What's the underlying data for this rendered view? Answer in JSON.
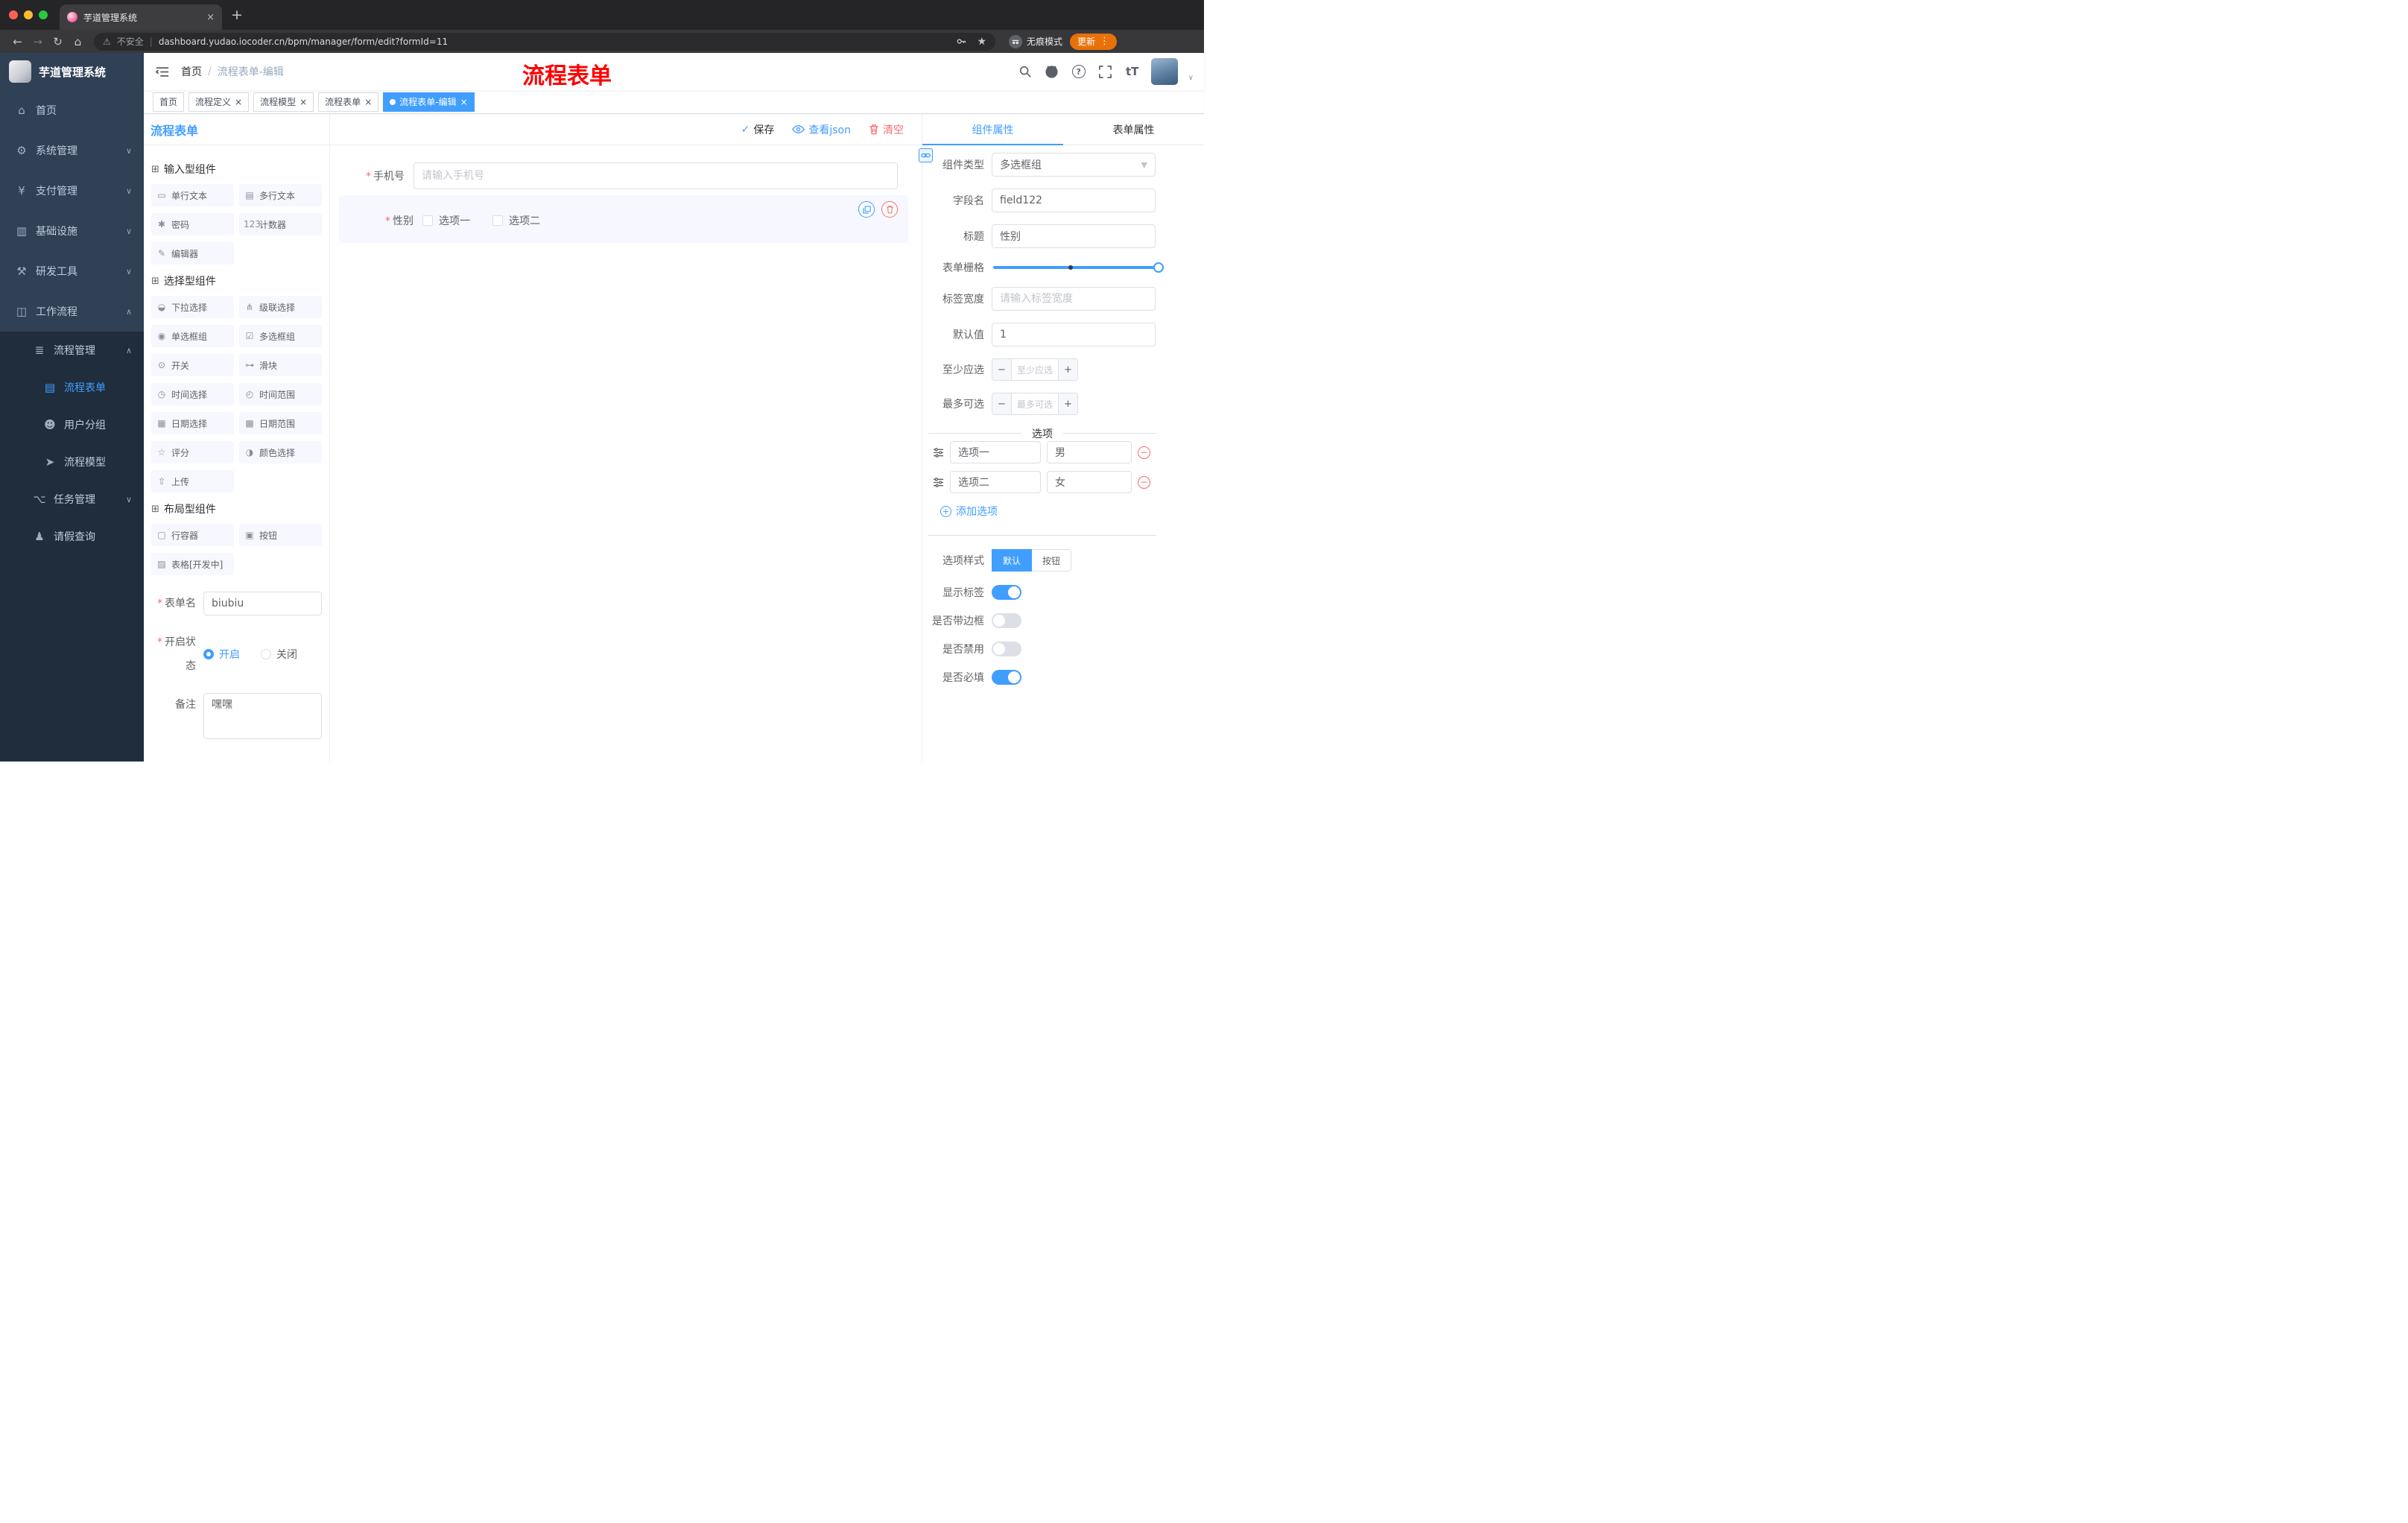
{
  "browser": {
    "tab_title": "芋道管理系统",
    "security_label": "不安全",
    "url": "dashboard.yudao.iocoder.cn/bpm/manager/form/edit?formId=11",
    "incognito_label": "无痕模式",
    "update_label": "更新"
  },
  "sidebar": {
    "logo_title": "芋道管理系统",
    "menu": [
      {
        "label": "首页",
        "icon": "⌂",
        "cls": "lvl0",
        "chev": ""
      },
      {
        "label": "系统管理",
        "icon": "⚙",
        "cls": "lvl0",
        "chev": "∨"
      },
      {
        "label": "支付管理",
        "icon": "¥",
        "cls": "lvl0",
        "chev": "∨"
      },
      {
        "label": "基础设施",
        "icon": "▥",
        "cls": "lvl0",
        "chev": "∨"
      },
      {
        "label": "研发工具",
        "icon": "⚒",
        "cls": "lvl0",
        "chev": "∨"
      },
      {
        "label": "工作流程",
        "icon": "◫",
        "cls": "lvl0",
        "chev": "∧"
      },
      {
        "label": "流程管理",
        "icon": "≣",
        "cls": "lvl1 sub",
        "chev": "∧"
      },
      {
        "label": "流程表单",
        "icon": "▤",
        "cls": "lvl2 sub active",
        "chev": ""
      },
      {
        "label": "用户分组",
        "icon": "☻",
        "cls": "lvl2 sub",
        "chev": ""
      },
      {
        "label": "流程模型",
        "icon": "➤",
        "cls": "lvl2 sub",
        "chev": ""
      },
      {
        "label": "任务管理",
        "icon": "⌥",
        "cls": "lvl1 sub",
        "chev": "∨"
      },
      {
        "label": "请假查询",
        "icon": "♟",
        "cls": "lvl1 sub",
        "chev": ""
      }
    ]
  },
  "header": {
    "breadcrumb": [
      "首页",
      "流程表单-编辑"
    ],
    "separator": "/",
    "overlay_title": "流程表单"
  },
  "tags": [
    {
      "label": "首页",
      "cls": ""
    },
    {
      "label": "流程定义",
      "cls": "closable"
    },
    {
      "label": "流程模型",
      "cls": "closable"
    },
    {
      "label": "流程表单",
      "cls": "closable"
    },
    {
      "label": "流程表单-编辑",
      "cls": "active closable"
    }
  ],
  "designer": {
    "panel_title": "流程表单",
    "actions": {
      "save": "保存",
      "view_json": "查看json",
      "clear": "清空"
    },
    "components": {
      "group1_title": "输入型组件",
      "group1": [
        {
          "label": "单行文本",
          "icon": "▭"
        },
        {
          "label": "多行文本",
          "icon": "▤"
        },
        {
          "label": "密码",
          "icon": "✱"
        },
        {
          "label": "计数器",
          "icon": "123"
        },
        {
          "label": "编辑器",
          "icon": "✎"
        }
      ],
      "group2_title": "选择型组件",
      "group2": [
        {
          "label": "下拉选择",
          "icon": "◒"
        },
        {
          "label": "级联选择",
          "icon": "⋔"
        },
        {
          "label": "单选框组",
          "icon": "◉"
        },
        {
          "label": "多选框组",
          "icon": "☑"
        },
        {
          "label": "开关",
          "icon": "⊙"
        },
        {
          "label": "滑块",
          "icon": "⊶"
        },
        {
          "label": "时间选择",
          "icon": "◷"
        },
        {
          "label": "时间范围",
          "icon": "◴"
        },
        {
          "label": "日期选择",
          "icon": "▦"
        },
        {
          "label": "日期范围",
          "icon": "▩"
        },
        {
          "label": "评分",
          "icon": "☆"
        },
        {
          "label": "颜色选择",
          "icon": "◑"
        },
        {
          "label": "上传",
          "icon": "⇧"
        }
      ],
      "group3_title": "布局型组件",
      "group3": [
        {
          "label": "行容器",
          "icon": "▢"
        },
        {
          "label": "按钮",
          "icon": "▣"
        },
        {
          "label": "表格[开发中]",
          "icon": "▨"
        }
      ]
    },
    "meta": {
      "name_label": "表单名",
      "name_value": "biubiu",
      "status_label": "开启状态",
      "status_on": "开启",
      "status_off": "关闭",
      "remark_label": "备注",
      "remark_value": "嘿嘿"
    },
    "canvas": {
      "phone_label": "手机号",
      "phone_placeholder": "请输入手机号",
      "gender_label": "性别",
      "gender_options": [
        "选项一",
        "选项二"
      ]
    },
    "props": {
      "tab_component": "组件属性",
      "tab_form": "表单属性",
      "component_type_label": "组件类型",
      "component_type_value": "多选框组",
      "field_label": "字段名",
      "field_value": "field122",
      "title_label": "标题",
      "title_value": "性别",
      "grid_label": "表单栅格",
      "label_width_label": "标签宽度",
      "label_width_placeholder": "请输入标签宽度",
      "default_label": "默认值",
      "default_value": "1",
      "min_label": "至少应选",
      "min_placeholder": "至少应选",
      "max_label": "最多可选",
      "max_placeholder": "最多可选",
      "options_title": "选项",
      "options": [
        {
          "label": "选项一",
          "value": "男"
        },
        {
          "label": "选项二",
          "value": "女"
        }
      ],
      "add_option": "添加选项",
      "style_label": "选项样式",
      "style_options": [
        {
          "label": "默认",
          "cls": "active"
        },
        {
          "label": "按钮",
          "cls": ""
        }
      ],
      "switches": [
        {
          "label": "显示标签",
          "cls": "on"
        },
        {
          "label": "是否带边框",
          "cls": ""
        },
        {
          "label": "是否禁用",
          "cls": ""
        },
        {
          "label": "是否必填",
          "cls": "on"
        }
      ]
    }
  },
  "colors": {
    "primary": "#409EFF",
    "danger": "#F56C6C",
    "sidebar": "#304156",
    "sidebar_submenu": "#1F2D3D",
    "annotation_red": "#FF0000",
    "update_button": "#E8710A"
  }
}
